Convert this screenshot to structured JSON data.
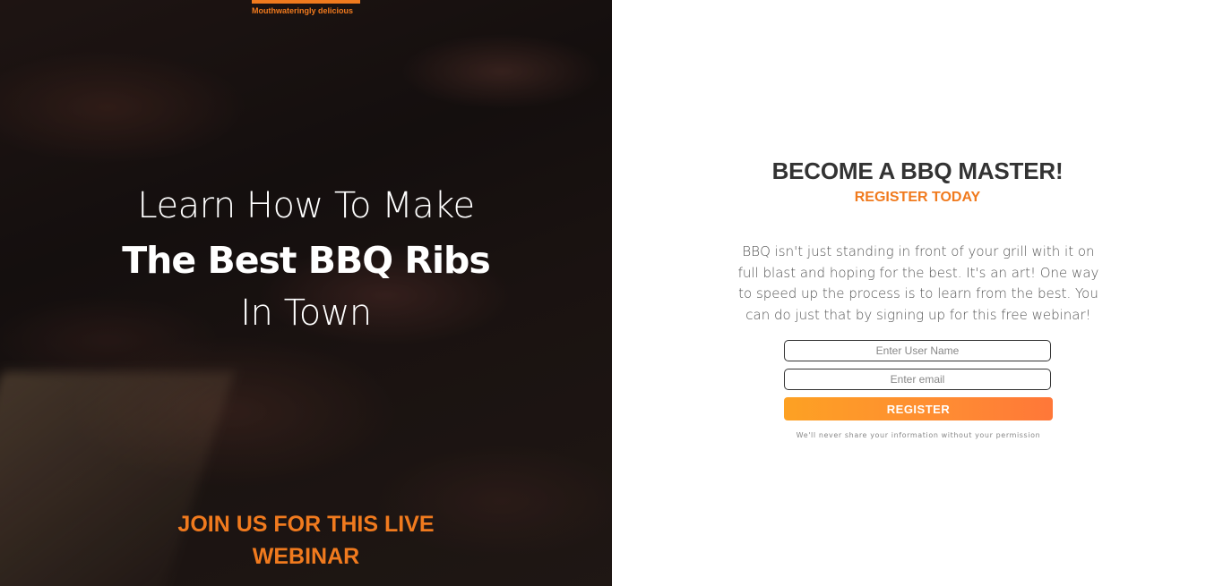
{
  "hero": {
    "tagline": "Mouthwateringly delicious",
    "headline_line1": "Learn How To Make",
    "headline_line2": "The Best BBQ Ribs",
    "headline_line3": "In Town",
    "cta_text": "JOIN US FOR THIS LIVE WEBINAR"
  },
  "form_panel": {
    "title": "BECOME A BBQ MASTER!",
    "subtitle": "REGISTER TODAY",
    "description": "BBQ isn't just standing in front of your grill with it on full blast and hoping for the best. It's an art! One way to speed up the process is to learn from the best. You can do just that by signing up for this free webinar!",
    "username_placeholder": "Enter User Name",
    "email_placeholder": "Enter email",
    "register_label": "REGISTER",
    "privacy_note": "We'll never share your information without your permission"
  },
  "colors": {
    "accent": "#f07a1e",
    "button_gradient_start": "#fda123",
    "button_gradient_end": "#ff7738",
    "title_text": "#333333"
  }
}
